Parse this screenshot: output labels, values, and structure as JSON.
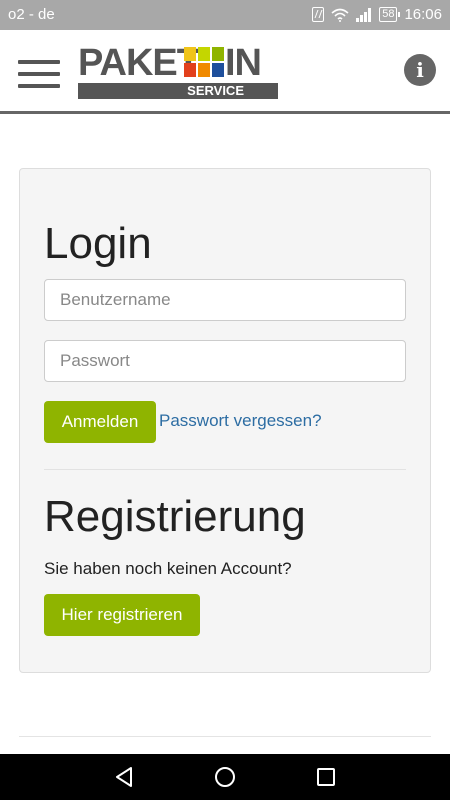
{
  "status_bar": {
    "carrier": "o2 - de",
    "battery": "58",
    "time": "16:06"
  },
  "header": {
    "logo_word_1": "PAKET",
    "logo_word_2": "IN",
    "logo_banner": "SERVICE",
    "logo_colors": [
      "#f0c419",
      "#c4d600",
      "#8fb400",
      "#e2401c",
      "#f08a00",
      "#1e4f9c"
    ],
    "info_icon": "i"
  },
  "login": {
    "title": "Login",
    "username_placeholder": "Benutzername",
    "password_placeholder": "Passwort",
    "submit_label": "Anmelden",
    "forgot_link": "Passwort vergessen?"
  },
  "register": {
    "title": "Registrierung",
    "text": "Sie haben noch keinen Account?",
    "button_label": "Hier registrieren"
  },
  "colors": {
    "accent": "#8fb400",
    "link": "#2d6da3",
    "status_bar": "#a8a8a8"
  }
}
